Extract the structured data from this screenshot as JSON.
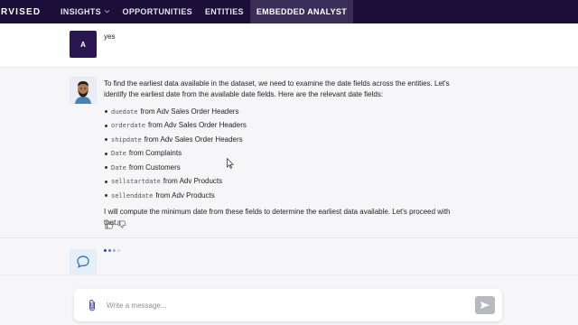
{
  "nav": {
    "logo": "RVISED",
    "items": [
      {
        "label": "INSIGHTS",
        "has_dropdown": true,
        "active": false
      },
      {
        "label": "OPPORTUNITIES",
        "active": false
      },
      {
        "label": "ENTITIES",
        "active": false
      },
      {
        "label": "EMBEDDED ANALYST",
        "active": true
      }
    ]
  },
  "user_message": {
    "avatar_initial": "A",
    "text": "yes"
  },
  "assistant_message": {
    "intro": "To find the earliest data available in the dataset, we need to examine the date fields across the entities. Let's identify the earliest date from the available date fields. Here are the relevant date fields:",
    "fields": [
      {
        "code": "duedate",
        "text": "from Adv Sales Order Headers"
      },
      {
        "code": "orderdate",
        "text": "from Adv Sales Order Headers"
      },
      {
        "code": "shipdate",
        "text": "from Adv Sales Order Headers"
      },
      {
        "code": "Date",
        "text": "from Complaints"
      },
      {
        "code": "Date",
        "text": "from Customers"
      },
      {
        "code": "sellstartdate",
        "text": "from Adv Products"
      },
      {
        "code": "sellenddate",
        "text": "from Adv Products"
      }
    ],
    "outro": "I will compute the minimum date from these fields to determine the earliest data available. Let's proceed with that."
  },
  "composer": {
    "placeholder": "Write a message..."
  },
  "colors": {
    "nav_bg": "#1b0f3a",
    "nav_active_bg": "#3a2e58",
    "user_avatar_bg": "#2a1651",
    "loading_dots": [
      "#3a3f8f",
      "#5a6dc4",
      "#8fb0e8",
      "#c3d8f4"
    ],
    "send_button": "#b8b8c0"
  }
}
